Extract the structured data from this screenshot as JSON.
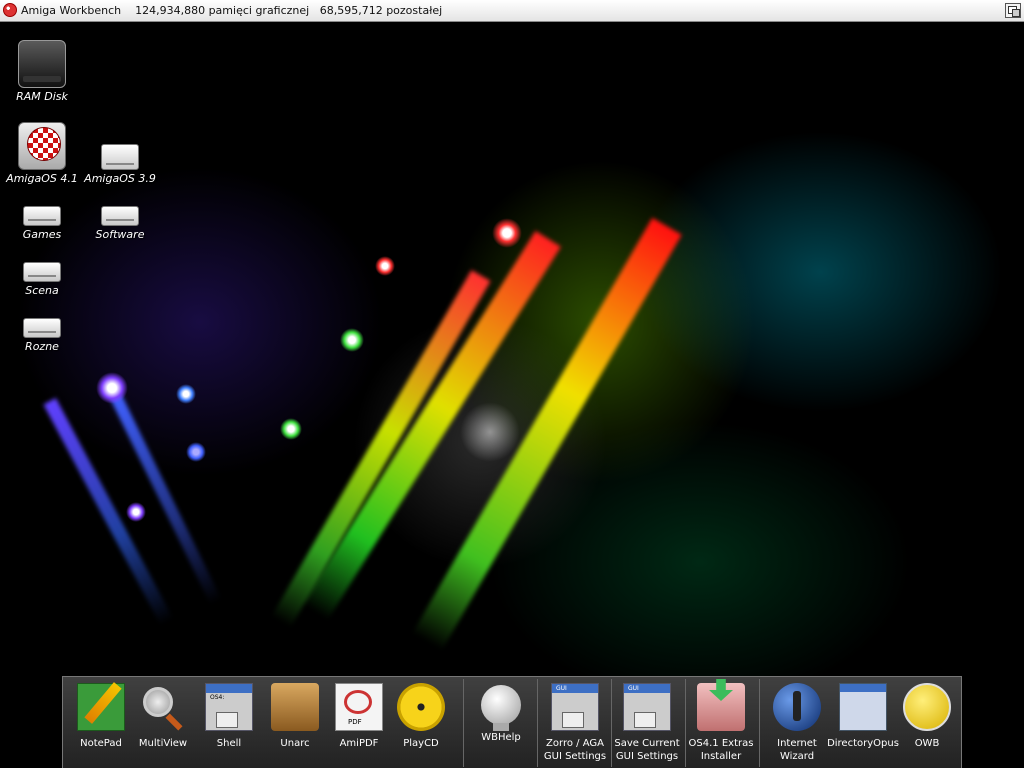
{
  "menubar": {
    "title": "Amiga Workbench    124,934,880 pamięci graficznej   68,595,712 pozostałej"
  },
  "desktop_icons": [
    {
      "label": "RAM Disk",
      "icon": "ram-disk-drive-icon"
    },
    {
      "label": "AmigaOS 4.1",
      "icon": "boing-ball-drive-icon"
    },
    {
      "label": "AmigaOS 3.9",
      "icon": "boing-ball-small-drive-icon"
    },
    {
      "label": "Games",
      "icon": "hard-drive-icon"
    },
    {
      "label": "Software",
      "icon": "hard-drive-icon"
    },
    {
      "label": "Scena",
      "icon": "hard-drive-icon"
    },
    {
      "label": "Rozne",
      "icon": "hard-drive-icon"
    }
  ],
  "dock": {
    "items": [
      {
        "label": "NotePad",
        "icon": "notepad-icon"
      },
      {
        "label": "MultiView",
        "icon": "magnifier-icon"
      },
      {
        "label": "Shell",
        "icon": "shell-window-icon",
        "icon_text": "OS4:"
      },
      {
        "label": "Unarc",
        "icon": "archive-box-icon"
      },
      {
        "label": "AmiPDF",
        "icon": "pdf-icon",
        "icon_text": "PDF"
      },
      {
        "label": "PlayCD",
        "icon": "cd-icon"
      },
      {
        "label": "WBHelp",
        "icon": "lightbulb-icon"
      },
      {
        "label": "Zorro / AGA\nGUI Settings",
        "icon": "gui-settings-icon",
        "icon_text": "GUI"
      },
      {
        "label": "Save Current\nGUI Settings",
        "icon": "gui-save-icon",
        "icon_text": "GUI"
      },
      {
        "label": "OS4.1 Extras\nInstaller",
        "icon": "installer-icon"
      },
      {
        "label": "Internet\nWizard",
        "icon": "globe-icon"
      },
      {
        "label": "DirectoryOpus",
        "icon": "directory-opus-icon"
      },
      {
        "label": "OWB",
        "icon": "owb-icon"
      }
    ]
  },
  "colors": {
    "menubar_bg": "#f0f0f0",
    "dock_bg": "#333333",
    "desktop_bg": "#000000"
  }
}
